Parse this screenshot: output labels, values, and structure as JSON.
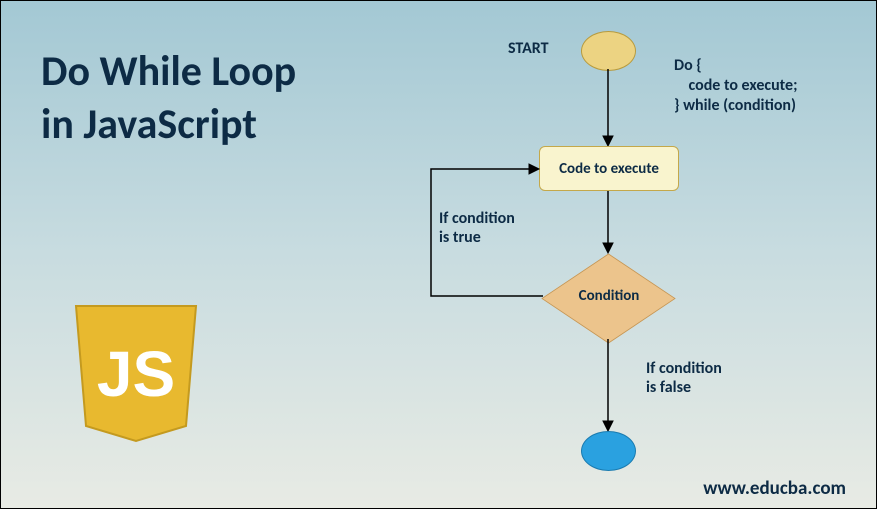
{
  "title_line1": "Do While Loop",
  "title_line2": "in JavaScript",
  "logo_text": "JS",
  "footer": "www.educba.com",
  "flowchart": {
    "start_label": "START",
    "code_annotation": "Do {\n    code to execute;\n} while (condition)",
    "code_box": "Code to execute",
    "condition": "Condition",
    "true_label": "If condition\nis true",
    "false_label": "If condition\nis false"
  },
  "chart_data": {
    "type": "flowchart",
    "title": "Do While Loop in JavaScript",
    "nodes": [
      {
        "id": "start",
        "type": "terminal",
        "label": "START"
      },
      {
        "id": "code",
        "type": "process",
        "label": "Code to execute"
      },
      {
        "id": "cond",
        "type": "decision",
        "label": "Condition"
      },
      {
        "id": "end",
        "type": "terminal",
        "label": ""
      }
    ],
    "edges": [
      {
        "from": "start",
        "to": "code",
        "label": ""
      },
      {
        "from": "code",
        "to": "cond",
        "label": ""
      },
      {
        "from": "cond",
        "to": "code",
        "label": "If condition is true"
      },
      {
        "from": "cond",
        "to": "end",
        "label": "If condition is false"
      }
    ],
    "syntax": "Do {\n    code to execute;\n} while (condition)"
  }
}
